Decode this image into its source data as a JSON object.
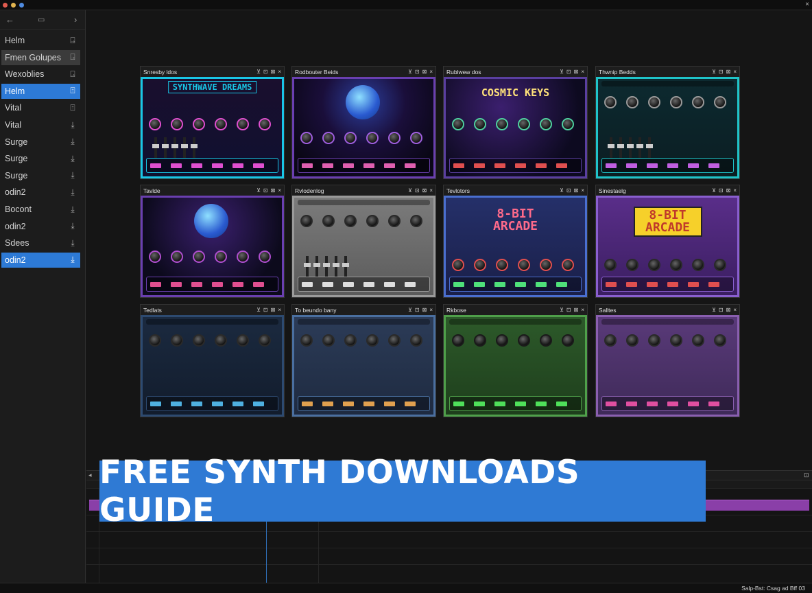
{
  "titlebar": {
    "dots": [
      "#e05b4f",
      "#e0b34f",
      "#4f8be0"
    ],
    "close_glyph": "×"
  },
  "sidebar": {
    "nav": {
      "back": "←",
      "grid": "▭",
      "forward": "›"
    },
    "items": [
      {
        "label": "Helm",
        "icon": "save-icon",
        "glyph": "⍈",
        "state": "normal"
      },
      {
        "label": "Fmen Golupes",
        "icon": "save-icon",
        "glyph": "⍈",
        "state": "highlight"
      },
      {
        "label": "Wexoblies",
        "icon": "save-icon",
        "glyph": "⍈",
        "state": "normal"
      },
      {
        "label": "Helm",
        "icon": "save-icon",
        "glyph": "⍐",
        "state": "selected"
      },
      {
        "label": "Vital",
        "icon": "save-icon",
        "glyph": "⍐",
        "state": "normal"
      },
      {
        "label": "Vital",
        "icon": "download-icon",
        "glyph": "⤓",
        "state": "normal"
      },
      {
        "label": "Surge",
        "icon": "download-icon",
        "glyph": "⤓",
        "state": "normal"
      },
      {
        "label": "Surge",
        "icon": "download-icon",
        "glyph": "⤓",
        "state": "normal"
      },
      {
        "label": "Surge",
        "icon": "download-icon",
        "glyph": "⤓",
        "state": "normal"
      },
      {
        "label": "odin2",
        "icon": "download-icon",
        "glyph": "⤓",
        "state": "normal"
      },
      {
        "label": "Bocont",
        "icon": "download-icon",
        "glyph": "⤓",
        "state": "normal"
      },
      {
        "label": "odin2",
        "icon": "download-icon",
        "glyph": "⤓",
        "state": "normal"
      },
      {
        "label": "Sdees",
        "icon": "download-icon",
        "glyph": "⤓",
        "state": "normal"
      },
      {
        "label": "odin2",
        "icon": "download-icon",
        "glyph": "⤓",
        "state": "selected"
      }
    ]
  },
  "windows": [
    {
      "title": "Snresby ldos",
      "banner": "SYNTHWAVE DREAMS",
      "theme": "synthwave"
    },
    {
      "title": "Rodbouter Beids",
      "banner": "",
      "theme": "planet"
    },
    {
      "title": "Rublwew dos",
      "banner": "COSMIC KEYS",
      "theme": "cosmic"
    },
    {
      "title": "Thwnip Bedds",
      "banner": "",
      "theme": "teal"
    },
    {
      "title": "Tavlde",
      "banner": "",
      "theme": "space"
    },
    {
      "title": "Rvlodenlog",
      "banner": "",
      "theme": "gray"
    },
    {
      "title": "Tevlotors",
      "banner": "8-BIT ARCADE",
      "theme": "arcade"
    },
    {
      "title": "Sinestaelg",
      "banner": "8-BIT ARCADE",
      "theme": "arcade2"
    },
    {
      "title": "Tedlats",
      "banner": "",
      "theme": "navy"
    },
    {
      "title": "To beundo bany",
      "banner": "",
      "theme": "steel"
    },
    {
      "title": "Rkbose",
      "banner": "",
      "theme": "green"
    },
    {
      "title": "Salltes",
      "banner": "",
      "theme": "purple"
    }
  ],
  "window_controls": [
    "⊻",
    "⊡",
    "⊠",
    "×"
  ],
  "guide": {
    "text": "FREE SYNTH DOWNLOADS GUIDE"
  },
  "statusbar": {
    "text": "Salp-Bst: Csag ad  Bff 03"
  },
  "colors": {
    "accent": "#2f7ad4",
    "selected": "#2d7ad6",
    "clip": "#8a3fa8"
  }
}
